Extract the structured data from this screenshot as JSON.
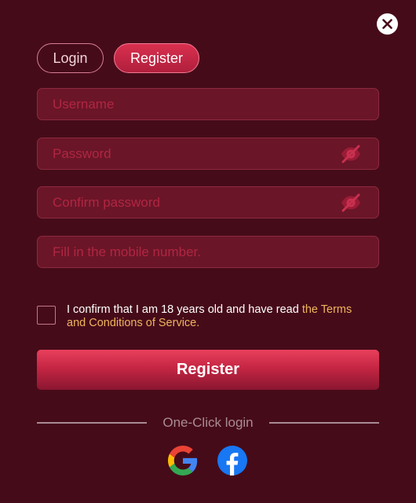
{
  "tabs": [
    {
      "label": "Login",
      "active": false
    },
    {
      "label": "Register",
      "active": true
    }
  ],
  "fields": {
    "username": {
      "placeholder": "Username",
      "value": ""
    },
    "password": {
      "placeholder": "Password",
      "value": ""
    },
    "confirm_password": {
      "placeholder": "Confirm password",
      "value": ""
    },
    "mobile": {
      "placeholder": "Fill in the mobile number.",
      "value": ""
    }
  },
  "consent": {
    "checked": false,
    "text": "I confirm that I am 18 years old and have read ",
    "link": "the Terms and Conditions of Service."
  },
  "submit_label": "Register",
  "one_click_label": "One-Click login",
  "icons": {
    "close": "close-icon",
    "password_toggle": "eye-slash-icon",
    "google": "google-icon",
    "facebook": "facebook-icon"
  },
  "colors": {
    "background": "#460b19",
    "accent": "#d9304f",
    "link": "#efb55e",
    "placeholder": "#b02642"
  }
}
